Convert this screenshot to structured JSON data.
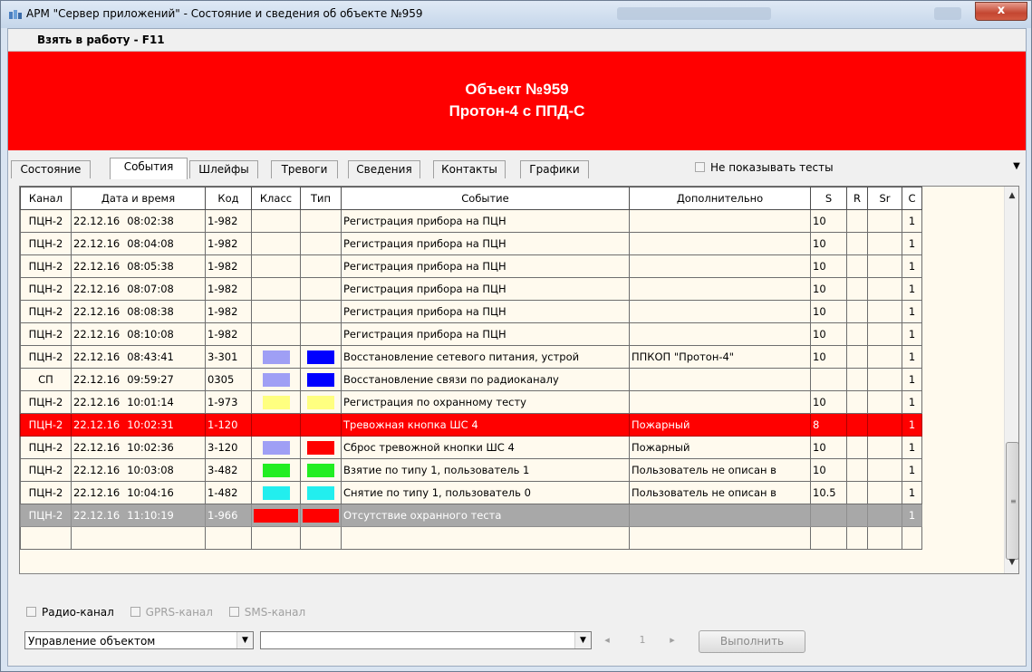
{
  "window": {
    "title": "АРМ \"Сервер приложений\" - Состояние и сведения об объекте №959",
    "close_label": "x"
  },
  "toolbar": {
    "take_work": "Взять в работу - F11"
  },
  "banner": {
    "line1": "Объект №959",
    "line2": "Протон-4 с ППД-С",
    "color": "#ff0000"
  },
  "tabs": [
    "Состояние",
    "События",
    "Шлейфы",
    "Тревоги",
    "Сведения",
    "Контакты",
    "Графики"
  ],
  "active_tab": "События",
  "hide_tests": {
    "label": "Не показывать тесты",
    "checked": false
  },
  "columns": [
    "Канал",
    "Дата и время",
    "Код",
    "Класс",
    "Тип",
    "Событие",
    "Дополнительно",
    "S",
    "R",
    "Sr",
    "C"
  ],
  "rows": [
    {
      "channel": "ПЦН-2",
      "date": "22.12.16",
      "time": "08:02:38",
      "code": "1-982",
      "class_color": "",
      "type_color": "",
      "event": "Регистрация прибора на ПЦН",
      "extra": "",
      "s": "10",
      "r": "",
      "sr": "",
      "c": "1",
      "style": "normal"
    },
    {
      "channel": "ПЦН-2",
      "date": "22.12.16",
      "time": "08:04:08",
      "code": "1-982",
      "class_color": "",
      "type_color": "",
      "event": "Регистрация прибора на ПЦН",
      "extra": "",
      "s": "10",
      "r": "",
      "sr": "",
      "c": "1",
      "style": "normal"
    },
    {
      "channel": "ПЦН-2",
      "date": "22.12.16",
      "time": "08:05:38",
      "code": "1-982",
      "class_color": "",
      "type_color": "",
      "event": "Регистрация прибора на ПЦН",
      "extra": "",
      "s": "10",
      "r": "",
      "sr": "",
      "c": "1",
      "style": "normal"
    },
    {
      "channel": "ПЦН-2",
      "date": "22.12.16",
      "time": "08:07:08",
      "code": "1-982",
      "class_color": "",
      "type_color": "",
      "event": "Регистрация прибора на ПЦН",
      "extra": "",
      "s": "10",
      "r": "",
      "sr": "",
      "c": "1",
      "style": "normal"
    },
    {
      "channel": "ПЦН-2",
      "date": "22.12.16",
      "time": "08:08:38",
      "code": "1-982",
      "class_color": "",
      "type_color": "",
      "event": "Регистрация прибора на ПЦН",
      "extra": "",
      "s": "10",
      "r": "",
      "sr": "",
      "c": "1",
      "style": "normal"
    },
    {
      "channel": "ПЦН-2",
      "date": "22.12.16",
      "time": "08:10:08",
      "code": "1-982",
      "class_color": "",
      "type_color": "",
      "event": "Регистрация прибора на ПЦН",
      "extra": "",
      "s": "10",
      "r": "",
      "sr": "",
      "c": "1",
      "style": "normal"
    },
    {
      "channel": "ПЦН-2",
      "date": "22.12.16",
      "time": "08:43:41",
      "code": "3-301",
      "class_color": "#9f9ff5",
      "type_color": "#0000ff",
      "event": "Восстановление сетевого питания, устрой",
      "extra": "ППКОП \"Протон-4\"",
      "s": "10",
      "r": "",
      "sr": "",
      "c": "1",
      "style": "normal"
    },
    {
      "channel": "СП",
      "date": "22.12.16",
      "time": "09:59:27",
      "code": "0305",
      "class_color": "#9f9ff5",
      "type_color": "#0000ff",
      "event": "Восстановление связи по радиоканалу",
      "extra": "",
      "s": "",
      "r": "",
      "sr": "",
      "c": "1",
      "style": "normal"
    },
    {
      "channel": "ПЦН-2",
      "date": "22.12.16",
      "time": "10:01:14",
      "code": "1-973",
      "class_color": "#ffff80",
      "type_color": "#ffff80",
      "event": "Регистрация по охранному тесту",
      "extra": "",
      "s": "10",
      "r": "",
      "sr": "",
      "c": "1",
      "style": "normal"
    },
    {
      "channel": "ПЦН-2",
      "date": "22.12.16",
      "time": "10:02:31",
      "code": "1-120",
      "class_color": "#ff0000",
      "type_color": "#ff0000",
      "event": "Тревожная кнопка ШС 4",
      "extra": "Пожарный",
      "s": "8",
      "r": "",
      "sr": "",
      "c": "1",
      "style": "alarm"
    },
    {
      "channel": "ПЦН-2",
      "date": "22.12.16",
      "time": "10:02:36",
      "code": "3-120",
      "class_color": "#9f9ff5",
      "type_color": "#ff0000",
      "event": "Сброс тревожной кнопки ШС 4",
      "extra": "Пожарный",
      "s": "10",
      "r": "",
      "sr": "",
      "c": "1",
      "style": "normal"
    },
    {
      "channel": "ПЦН-2",
      "date": "22.12.16",
      "time": "10:03:08",
      "code": "3-482",
      "class_color": "#22ee22",
      "type_color": "#22ee22",
      "event": "Взятие по типу 1, пользователь 1",
      "extra": "Пользователь не описан в",
      "s": "10",
      "r": "",
      "sr": "",
      "c": "1",
      "style": "normal"
    },
    {
      "channel": "ПЦН-2",
      "date": "22.12.16",
      "time": "10:04:16",
      "code": "1-482",
      "class_color": "#22eeee",
      "type_color": "#22eeee",
      "event": "Снятие по типу 1, пользователь 0",
      "extra": "Пользователь не описан в",
      "s": "10.5",
      "r": "",
      "sr": "",
      "c": "1",
      "style": "normal"
    },
    {
      "channel": "ПЦН-2",
      "date": "22.12.16",
      "time": "11:10:19",
      "code": "1-966",
      "class_color": "#ff0000",
      "type_color": "#ff0000",
      "event": "Отсутствие охранного теста",
      "extra": "",
      "s": "",
      "r": "",
      "sr": "",
      "c": "1",
      "style": "sel"
    }
  ],
  "channels": [
    {
      "label": "Радио-канал",
      "enabled": true
    },
    {
      "label": "GPRS-канал",
      "enabled": false
    },
    {
      "label": "SMS-канал",
      "enabled": false
    }
  ],
  "control": {
    "action_value": "Управление объектом",
    "command_value": "",
    "page_value": "1",
    "execute_label": "Выполнить"
  }
}
